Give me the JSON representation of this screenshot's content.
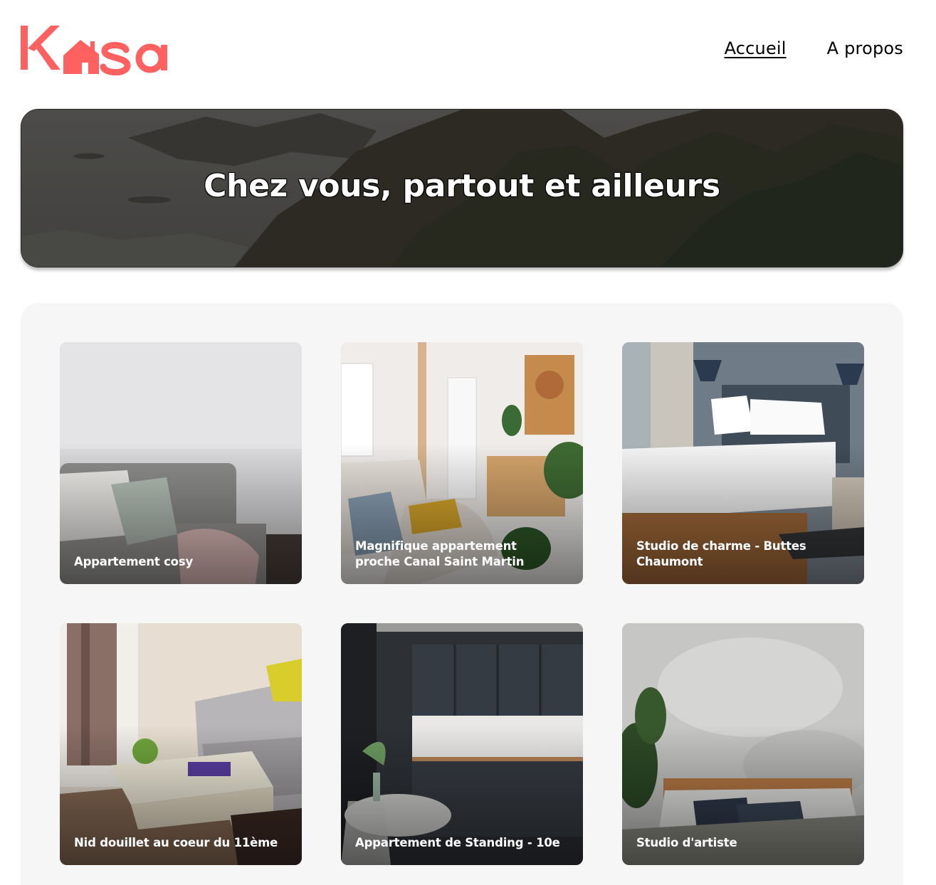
{
  "header": {
    "logo_text": "Kasa",
    "nav": [
      {
        "label": "Accueil",
        "active": true
      },
      {
        "label": "A propos",
        "active": false
      }
    ]
  },
  "colors": {
    "brand": "#ff6060",
    "gallery_bg": "#f6f6f6"
  },
  "banner": {
    "title": "Chez vous, partout et ailleurs"
  },
  "gallery": {
    "cards": [
      {
        "title": "Appartement cosy"
      },
      {
        "title": "Magnifique appartement proche Canal Saint Martin"
      },
      {
        "title": "Studio de charme - Buttes Chaumont"
      },
      {
        "title": "Nid douillet au coeur du 11ème"
      },
      {
        "title": "Appartement de Standing - 10e"
      },
      {
        "title": "Studio d'artiste"
      }
    ]
  }
}
